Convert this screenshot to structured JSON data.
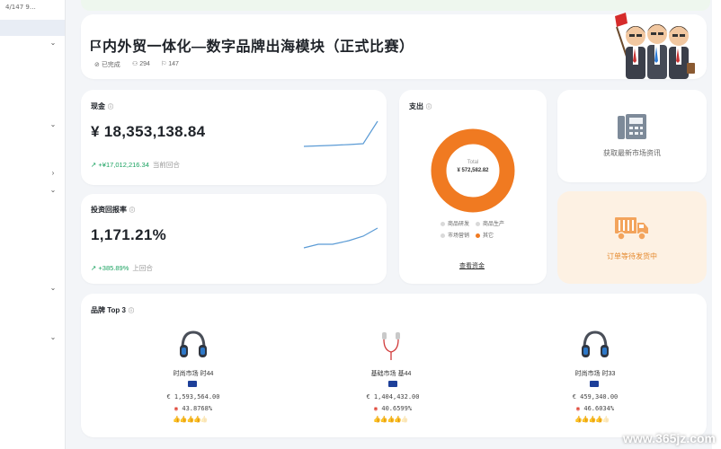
{
  "sidebar": {
    "top_text": "4/147 9…",
    "chevrons": [
      "⌄",
      "⌄",
      "›",
      "⌄",
      "⌄",
      "⌄"
    ]
  },
  "header": {
    "title": "内外贸一体化—数字品牌出海模块（正式比赛）",
    "status": "已完成",
    "participants": "294",
    "flags": "147"
  },
  "cash": {
    "label": "现金",
    "value": "¥ 18,353,138.84",
    "delta": "+¥17,012,216.34",
    "delta_note": "当前回合"
  },
  "roi": {
    "label": "投资回报率",
    "value": "1,171.21%",
    "delta": "+385.89%",
    "delta_note": "上回合"
  },
  "expense": {
    "label": "支出",
    "center_label": "Total",
    "center_value": "¥ 572,582.82",
    "legend": [
      "商品研发",
      "商品生产",
      "市场营销",
      "其它"
    ],
    "link": "查看资金"
  },
  "market_info": {
    "label": "获取最新市场资讯"
  },
  "orders": {
    "label": "订单等待发货中"
  },
  "brands": {
    "title": "品牌 Top 3",
    "items": [
      {
        "name": "时尚市场 时44",
        "amount": "€ 1,593,564.00",
        "pct": "43.8768%",
        "stars": 4
      },
      {
        "name": "基础市场 基44",
        "amount": "€ 1,404,432.00",
        "pct": "40.6599%",
        "stars": 4
      },
      {
        "name": "时尚市场 时33",
        "amount": "€ 459,340.00",
        "pct": "46.6034%",
        "stars": 4
      }
    ]
  },
  "watermark": "www.365jz.com",
  "chart_data": [
    {
      "type": "pie",
      "title": "支出",
      "categories": [
        "商品研发",
        "商品生产",
        "市场营销",
        "其它"
      ],
      "values": [
        0,
        0,
        0,
        572582.82
      ],
      "colors": [
        "#d9d9d9",
        "#d9d9d9",
        "#d9d9d9",
        "#f07a21"
      ]
    }
  ],
  "colors": {
    "accent_green": "#1aa260",
    "donut_orange": "#f07a21",
    "spark_blue": "#5b9bd5",
    "order_bg": "#fdf1e3"
  }
}
